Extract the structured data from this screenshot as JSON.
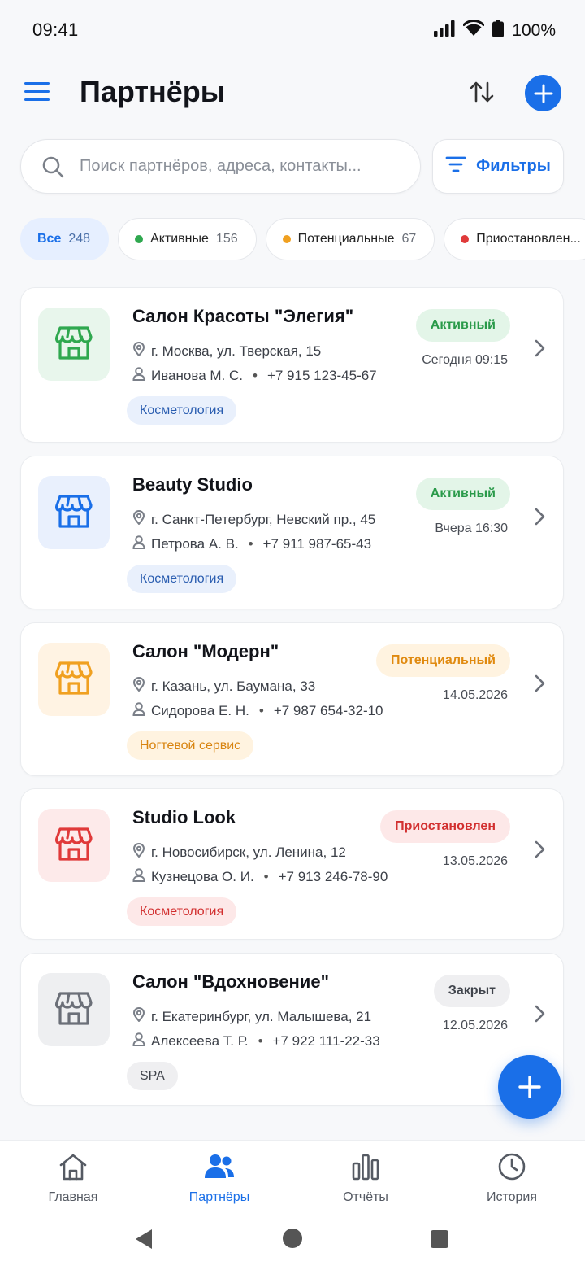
{
  "status_bar": {
    "time": "09:41",
    "battery": "100%"
  },
  "header": {
    "title": "Партнёры"
  },
  "search": {
    "placeholder": "Поиск партнёров, адреса, контакты..."
  },
  "filters_button": {
    "label": "Фильтры"
  },
  "chips": [
    {
      "label": "Все",
      "count": "248",
      "dot_color": "",
      "active": true
    },
    {
      "label": "Активные",
      "count": "156",
      "dot_color": "#2fa84f",
      "active": false
    },
    {
      "label": "Потенциальные",
      "count": "67",
      "dot_color": "#f0a020",
      "active": false
    },
    {
      "label": "Приостановлен...",
      "count": "",
      "dot_color": "#e03a3a",
      "active": false
    }
  ],
  "partners": [
    {
      "name": "Салон Красоты \"Элегия\"",
      "address": "г. Москва, ул. Тверская, 15",
      "contact": "Иванова М. С.",
      "phone": "+7 915 123-45-67",
      "tag": "Косметология",
      "status": "Активный",
      "date": "Сегодня 09:15",
      "icon": "store-icon",
      "icon_color": "#2fa84f",
      "icon_bg": "#e8f6ec",
      "status_color": "#2a9a4a",
      "status_bg": "#e3f5e8",
      "tag_color": "#2a5db0",
      "tag_bg": "#e9f0fc"
    },
    {
      "name": "Beauty Studio",
      "address": "г. Санкт-Петербург, Невский пр., 45",
      "contact": "Петрова А. В.",
      "phone": "+7 911 987-65-43",
      "tag": "Косметология",
      "status": "Активный",
      "date": "Вчера 16:30",
      "icon": "store-icon",
      "icon_color": "#1a6fe8",
      "icon_bg": "#e9f0fd",
      "status_color": "#2a9a4a",
      "status_bg": "#e3f5e8",
      "tag_color": "#2a5db0",
      "tag_bg": "#e9f0fc"
    },
    {
      "name": "Салон \"Модерн\"",
      "address": "г. Казань, ул. Баумана, 33",
      "contact": "Сидорова Е. Н.",
      "phone": "+7 987 654-32-10",
      "tag": "Ногтевой сервис",
      "status": "Потенциальный",
      "date": "14.05.2026",
      "icon": "store-icon",
      "icon_color": "#f0a020",
      "icon_bg": "#fff3e3",
      "status_color": "#e08a10",
      "status_bg": "#fff3e0",
      "tag_color": "#d88410",
      "tag_bg": "#fff3e0"
    },
    {
      "name": "Studio Look",
      "address": "г. Новосибирск, ул. Ленина, 12",
      "contact": "Кузнецова О. И.",
      "phone": "+7 913 246-78-90",
      "tag": "Косметология",
      "status": "Приостановлен",
      "date": "13.05.2026",
      "icon": "store-icon",
      "icon_color": "#e03a3a",
      "icon_bg": "#fdeaea",
      "status_color": "#d23030",
      "status_bg": "#fde8e8",
      "tag_color": "#d23030",
      "tag_bg": "#fde8e8"
    },
    {
      "name": "Салон \"Вдохновение\"",
      "address": "г. Екатеринбург, ул. Малышева, 21",
      "contact": "Алексеева Т. Р.",
      "phone": "+7 922 111-22-33",
      "tag": "SPA",
      "status": "Закрыт",
      "date": "12.05.2026",
      "icon": "store-icon",
      "icon_color": "#6b6f78",
      "icon_bg": "#eeeff1",
      "status_color": "#3f434b",
      "status_bg": "#efeff1",
      "tag_color": "#3f434b",
      "tag_bg": "#efeff1"
    }
  ],
  "bottom_nav": [
    {
      "label": "Главная",
      "icon": "home-icon",
      "active": false
    },
    {
      "label": "Партнёры",
      "icon": "partners-icon",
      "active": true
    },
    {
      "label": "Отчёты",
      "icon": "reports-icon",
      "active": false
    },
    {
      "label": "История",
      "icon": "history-icon",
      "active": false
    }
  ],
  "colors": {
    "accent": "#1a6fe8",
    "background": "#f7f8fa"
  }
}
